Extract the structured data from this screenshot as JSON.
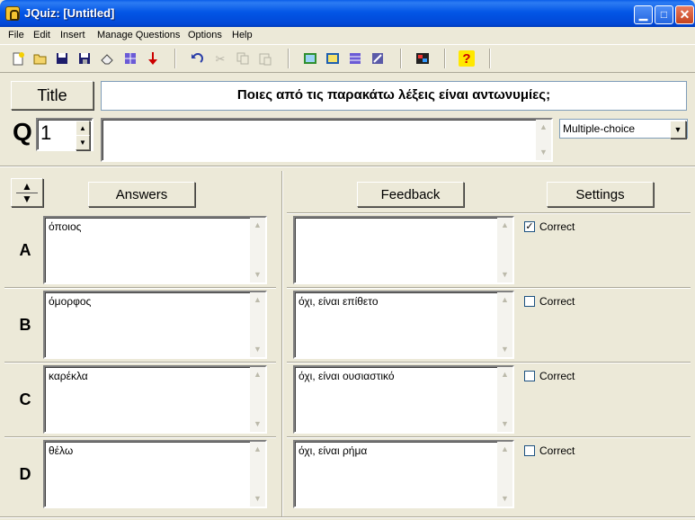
{
  "window": {
    "title": "JQuiz: [Untitled]"
  },
  "menu": [
    "File",
    "Edit",
    "Insert",
    "Manage Questions",
    "Options",
    "Help"
  ],
  "title_button": "Title",
  "quiz_title": "Ποιες από τις παρακάτω λέξεις είναι αντωνυμίες;",
  "question": {
    "label": "Q",
    "number": "1",
    "text": "",
    "type": "Multiple-choice"
  },
  "headers": {
    "answers": "Answers",
    "feedback": "Feedback",
    "settings": "Settings"
  },
  "rows": [
    {
      "letter": "A",
      "answer": "όποιος",
      "feedback": "",
      "correct": true,
      "correct_label": "Correct"
    },
    {
      "letter": "B",
      "answer": "όμορφος",
      "feedback": "όχι, είναι επίθετο",
      "correct": false,
      "correct_label": "Correct"
    },
    {
      "letter": "C",
      "answer": "καρέκλα",
      "feedback": "όχι, είναι ουσιαστικό",
      "correct": false,
      "correct_label": "Correct"
    },
    {
      "letter": "D",
      "answer": "θέλω",
      "feedback": "όχι, είναι ρήμα",
      "correct": false,
      "correct_label": "Correct"
    }
  ],
  "check_mark": "✓",
  "icons": {
    "toolbar": [
      "new-file-icon",
      "open-folder-icon",
      "save-icon",
      "save-as-icon",
      "eraser-icon",
      "web-page-icon",
      "insert-icon",
      "undo-icon",
      "cut-icon",
      "copy-icon",
      "paste-icon",
      "export-web-icon",
      "export-web2-icon",
      "export-print-icon",
      "export-drag-icon",
      "config-icon",
      "help-icon"
    ]
  },
  "colors": {
    "titlebar": "#0356e6",
    "face": "#ece9d8",
    "field_border": "#7f9db9"
  }
}
